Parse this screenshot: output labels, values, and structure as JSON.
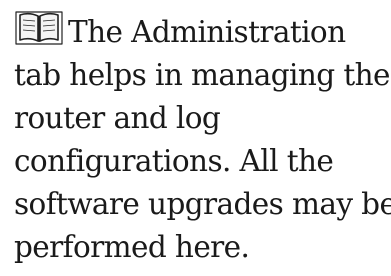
{
  "note": {
    "icon": "book-icon",
    "lines": [
      "The Administration",
      "tab helps in managing the",
      "router and log",
      "configurations. All the",
      "software upgrades may be",
      "performed here."
    ]
  }
}
